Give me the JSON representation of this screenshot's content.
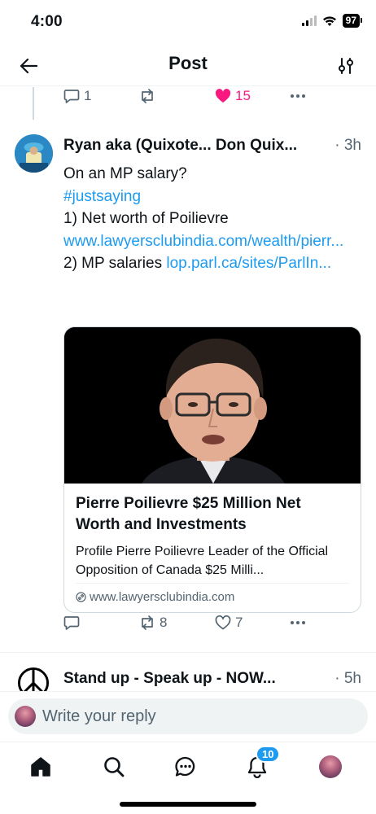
{
  "status_bar": {
    "time": "4:00",
    "battery": "97"
  },
  "header": {
    "title": "Post"
  },
  "parent_actions": {
    "replies": "1",
    "reposts": "",
    "likes": "15"
  },
  "tweet": {
    "author": "Ryan aka (Quixote... Don Quix...",
    "time": "· 3h",
    "line1": "On an MP salary?",
    "hashtag": "#justsaying",
    "line3": "1) Net worth of Poilievre",
    "link1": "www.lawyersclubindia.com/wealth/pierr...",
    "line5_prefix": "2) MP salaries ",
    "link2": "lop.parl.ca/sites/ParlIn..."
  },
  "card": {
    "title": "Pierre Poilievre $25 Million Net Worth and Investments",
    "description": "Profile Pierre Poilievre Leader of the Official Opposition of Canada $25 Milli...",
    "domain": "www.lawyersclubindia.com"
  },
  "tweet_actions": {
    "replies": "",
    "reposts": "8",
    "likes": "7"
  },
  "next_post": {
    "author": "Stand up - Speak up - NOW...",
    "time": "· 5h"
  },
  "reply_bar": {
    "placeholder": "Write your reply"
  },
  "tabbar": {
    "notifications_badge": "10"
  },
  "colors": {
    "accent": "#1d9bf0",
    "like": "#f91880",
    "muted": "#536471"
  }
}
